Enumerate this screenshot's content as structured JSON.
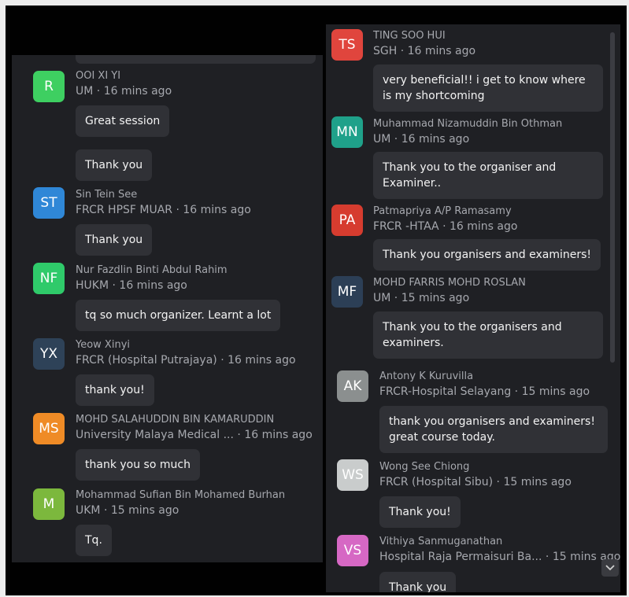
{
  "colors": {
    "panel_bg": "#1f2024",
    "bubble_bg": "#303136",
    "text_secondary": "#a6a8ae",
    "text_primary": "#f3f3f3"
  },
  "left_panel": {
    "messages": [
      {
        "initials": "R",
        "color": "#3ecf61",
        "name": "OOI XI YI",
        "org": "UM",
        "time": "16 mins ago",
        "bubbles": [
          "Great session",
          "Thank you"
        ]
      },
      {
        "initials": "ST",
        "color": "#2f87d7",
        "name": "Sin Tein See",
        "org": "FRCR HPSF MUAR",
        "time": "16 mins ago",
        "bubbles": [
          "Thank you"
        ]
      },
      {
        "initials": "NF",
        "color": "#2fca6a",
        "name": "Nur Fazdlin Binti Abdul Rahim",
        "org": "HUKM",
        "time": "16 mins ago",
        "bubbles": [
          "tq so much organizer. Learnt a lot"
        ]
      },
      {
        "initials": "YX",
        "color": "#2e4258",
        "name": "Yeow Xinyi",
        "org": "FRCR (Hospital Putrajaya)",
        "time": "16 mins ago",
        "bubbles": [
          "thank you!"
        ]
      },
      {
        "initials": "MS",
        "color": "#ef8b26",
        "name": "MOHD SALAHUDDIN BIN KAMARUDDIN",
        "org": "University Malaya Medical ...",
        "time": "16 mins ago",
        "bubbles": [
          "thank you so much"
        ]
      },
      {
        "initials": "M",
        "color": "#7cb83d",
        "name": "Mohammad Sufian Bin Mohamed Burhan",
        "org": "UKM",
        "time": "15 mins ago",
        "bubbles": [
          "Tq."
        ]
      }
    ]
  },
  "right_panel": {
    "messages": [
      {
        "initials": "TS",
        "color": "#e0453d",
        "name": "TING SOO HUI",
        "org": "SGH",
        "time": "16 mins ago",
        "bubbles": [
          "very beneficial!! i get to know where is my shortcoming"
        ]
      },
      {
        "initials": "MN",
        "color": "#1fa18a",
        "name": "Muhammad Nizamuddin Bin Othman",
        "org": "UM",
        "time": "16 mins ago",
        "bubbles": [
          "Thank you to the organiser and Examiner.."
        ]
      },
      {
        "initials": "PA",
        "color": "#d63c2f",
        "name": "Patmapriya A/P Ramasamy",
        "org": "FRCR -HTAA",
        "time": "16 mins ago",
        "bubbles": [
          "Thank you organisers and examiners!"
        ]
      },
      {
        "initials": "MF",
        "color": "#2c3f56",
        "name": "MOHD FARRIS MOHD ROSLAN",
        "org": "UM",
        "time": "15 mins ago",
        "bubbles": [
          "Thank you to the organisers and examiners."
        ]
      },
      {
        "initials": "AK",
        "color": "#8b8f8f",
        "name": "Antony K Kuruvilla",
        "org": "FRCR-Hospital Selayang",
        "time": "15 mins ago",
        "bubbles": [
          "thank you organisers and examiners! great course today."
        ]
      },
      {
        "initials": "WS",
        "color": "#c9cccc",
        "name": "Wong See Chiong",
        "org": "FRCR (Hospital Sibu)",
        "time": "15 mins ago",
        "bubbles": [
          "Thank you!"
        ]
      },
      {
        "initials": "VS",
        "color": "#d668c4",
        "name": "Vithiya Sanmuganathan",
        "org": "Hospital Raja Permaisuri Ba...",
        "time": "15 mins ago",
        "bubbles": [
          "Thank you"
        ]
      }
    ]
  }
}
